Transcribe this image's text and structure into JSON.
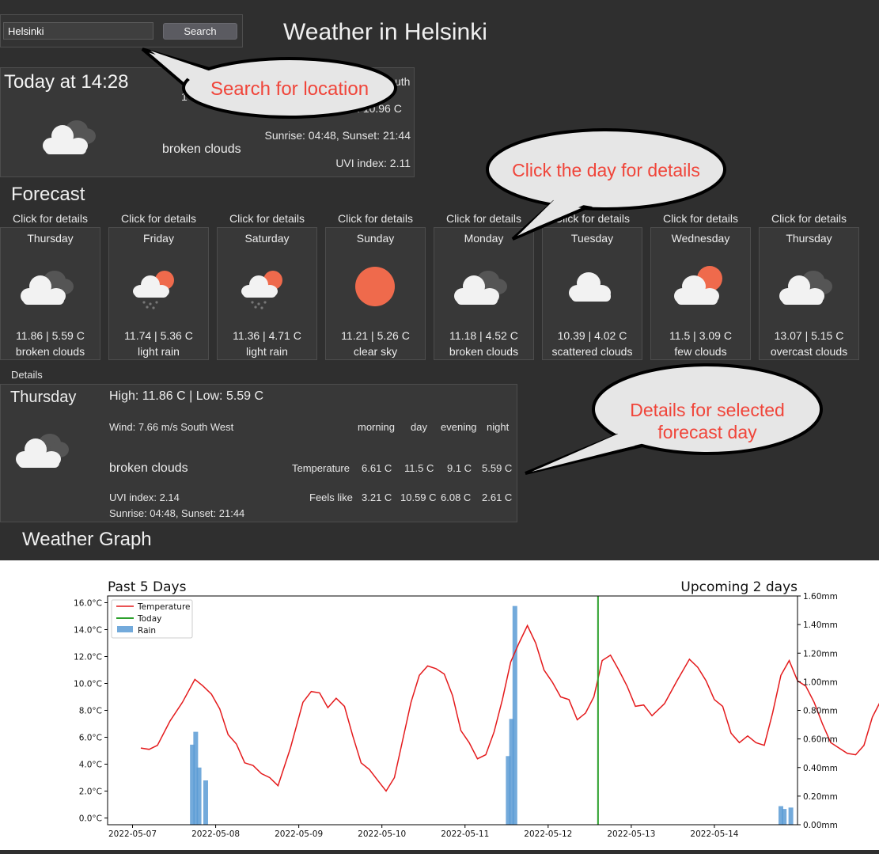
{
  "search": {
    "value": "Helsinki",
    "button_label": "Search"
  },
  "title": "Weather in Helsinki",
  "today": {
    "heading": "Today at 14:28",
    "wind_partial": "uth",
    "temp_partial_left": "1",
    "temp_partial_right": ". 10.96 C",
    "sun": "Sunrise: 04:48, Sunset: 21:44",
    "uvi": "UVI index: 2.11",
    "description": "broken clouds",
    "icon": "broken-clouds-icon"
  },
  "callouts": {
    "search": "Search for location",
    "click_day": "Click the day for details",
    "details": "Details for selected forecast day"
  },
  "forecast": {
    "heading": "Forecast",
    "click_label": "Click for details",
    "days": [
      {
        "name": "Thursday",
        "temps": "11.86 | 5.59 C",
        "desc": "broken clouds",
        "icon": "broken-clouds-icon"
      },
      {
        "name": "Friday",
        "temps": "11.74 | 5.36 C",
        "desc": "light rain",
        "icon": "light-rain-icon"
      },
      {
        "name": "Saturday",
        "temps": "11.36 | 4.71 C",
        "desc": "light rain",
        "icon": "light-rain-icon"
      },
      {
        "name": "Sunday",
        "temps": "11.21 | 5.26 C",
        "desc": "clear sky",
        "icon": "clear-sky-icon"
      },
      {
        "name": "Monday",
        "temps": "11.18 | 4.52 C",
        "desc": "broken clouds",
        "icon": "broken-clouds-icon"
      },
      {
        "name": "Tuesday",
        "temps": "10.39 | 4.02 C",
        "desc": "scattered clouds",
        "icon": "scattered-clouds-icon"
      },
      {
        "name": "Wednesday",
        "temps": "11.5 | 3.09 C",
        "desc": "few clouds",
        "icon": "few-clouds-icon"
      },
      {
        "name": "Thursday",
        "temps": "13.07 | 5.15 C",
        "desc": "overcast clouds",
        "icon": "overcast-clouds-icon"
      }
    ]
  },
  "details": {
    "label": "Details",
    "day": "Thursday",
    "high_low": "High: 11.86 C | Low: 5.59 C",
    "wind": "Wind: 7.66 m/s South West",
    "description": "broken clouds",
    "uvi": "UVI index: 2.14",
    "sun": "Sunrise: 04:48, Sunset: 21:44",
    "columns": [
      "morning",
      "day",
      "evening",
      "night"
    ],
    "rows": [
      {
        "label": "Temperature",
        "values": [
          "6.61 C",
          "11.5 C",
          "9.1 C",
          "5.59 C"
        ]
      },
      {
        "label": "Feels like",
        "values": [
          "3.21 C",
          "10.59 C",
          "6.08 C",
          "2.61 C"
        ]
      }
    ],
    "icon": "broken-clouds-icon"
  },
  "graph_heading": "Weather Graph",
  "chart_data": {
    "type": "line",
    "title_left": "Past 5 Days",
    "title_right": "Upcoming 2 days",
    "x_ticks": [
      "2022-05-07",
      "2022-05-08",
      "2022-05-09",
      "2022-05-10",
      "2022-05-11",
      "2022-05-12",
      "2022-05-13",
      "2022-05-14"
    ],
    "y_left_ticks": [
      "0.0°C",
      "2.0°C",
      "4.0°C",
      "6.0°C",
      "8.0°C",
      "10.0°C",
      "12.0°C",
      "14.0°C",
      "16.0°C"
    ],
    "y_right_ticks": [
      "0.00mm",
      "0.20mm",
      "0.40mm",
      "0.60mm",
      "0.80mm",
      "1.00mm",
      "1.20mm",
      "1.40mm",
      "1.60mm"
    ],
    "ylim_left": [
      -0.5,
      16.5
    ],
    "ylim_right": [
      0,
      1.6
    ],
    "xlim": [
      -0.3,
      8.0
    ],
    "legend": [
      "Temperature",
      "Today",
      "Rain"
    ],
    "legend_position": "top-left",
    "colors": {
      "temperature": "#e41a1c",
      "today": "#2ca02c",
      "rain": "#5b9bd5"
    },
    "today_x": 5.6,
    "temperature": [
      [
        0.1,
        5.2
      ],
      [
        0.2,
        5.1
      ],
      [
        0.3,
        5.4
      ],
      [
        0.45,
        7.2
      ],
      [
        0.6,
        8.6
      ],
      [
        0.75,
        10.3
      ],
      [
        0.85,
        9.8
      ],
      [
        0.95,
        9.2
      ],
      [
        1.05,
        8.1
      ],
      [
        1.15,
        6.2
      ],
      [
        1.25,
        5.5
      ],
      [
        1.35,
        4.1
      ],
      [
        1.45,
        3.9
      ],
      [
        1.55,
        3.3
      ],
      [
        1.65,
        3.0
      ],
      [
        1.75,
        2.4
      ],
      [
        1.9,
        5.2
      ],
      [
        2.05,
        8.6
      ],
      [
        2.15,
        9.4
      ],
      [
        2.25,
        9.3
      ],
      [
        2.35,
        8.2
      ],
      [
        2.45,
        8.9
      ],
      [
        2.55,
        8.3
      ],
      [
        2.65,
        6.1
      ],
      [
        2.75,
        4.1
      ],
      [
        2.85,
        3.6
      ],
      [
        2.95,
        2.8
      ],
      [
        3.05,
        2.0
      ],
      [
        3.15,
        3.0
      ],
      [
        3.25,
        5.8
      ],
      [
        3.35,
        8.6
      ],
      [
        3.45,
        10.6
      ],
      [
        3.55,
        11.3
      ],
      [
        3.65,
        11.1
      ],
      [
        3.75,
        10.7
      ],
      [
        3.85,
        9.1
      ],
      [
        3.95,
        6.5
      ],
      [
        4.05,
        5.6
      ],
      [
        4.15,
        4.4
      ],
      [
        4.25,
        4.7
      ],
      [
        4.35,
        6.4
      ],
      [
        4.45,
        8.8
      ],
      [
        4.55,
        11.6
      ],
      [
        4.65,
        13.0
      ],
      [
        4.75,
        14.3
      ],
      [
        4.85,
        13.0
      ],
      [
        4.95,
        11.0
      ],
      [
        5.05,
        10.1
      ],
      [
        5.15,
        9.0
      ],
      [
        5.25,
        8.8
      ],
      [
        5.35,
        7.3
      ],
      [
        5.45,
        7.8
      ],
      [
        5.55,
        9.0
      ],
      [
        5.65,
        11.7
      ],
      [
        5.75,
        12.1
      ],
      [
        5.85,
        11.0
      ],
      [
        5.95,
        9.8
      ],
      [
        6.05,
        8.3
      ],
      [
        6.15,
        8.4
      ],
      [
        6.25,
        7.6
      ],
      [
        6.4,
        8.5
      ],
      [
        6.55,
        10.2
      ],
      [
        6.7,
        11.8
      ],
      [
        6.8,
        11.2
      ],
      [
        6.9,
        10.2
      ],
      [
        7.0,
        8.8
      ],
      [
        7.1,
        8.3
      ],
      [
        7.2,
        6.3
      ],
      [
        7.3,
        5.6
      ],
      [
        7.4,
        6.1
      ],
      [
        7.5,
        5.6
      ],
      [
        7.6,
        5.4
      ],
      [
        7.7,
        7.8
      ],
      [
        7.8,
        10.6
      ],
      [
        7.9,
        11.7
      ],
      [
        8.0,
        10.2
      ],
      [
        8.1,
        9.8
      ],
      [
        8.2,
        8.6
      ],
      [
        8.3,
        7.0
      ],
      [
        8.4,
        5.6
      ],
      [
        8.5,
        5.2
      ],
      [
        8.6,
        4.8
      ],
      [
        8.7,
        4.7
      ],
      [
        8.8,
        5.4
      ],
      [
        8.9,
        7.5
      ],
      [
        9.0,
        8.7
      ],
      [
        9.1,
        10.4
      ],
      [
        9.2,
        11.0
      ]
    ],
    "rain": [
      [
        0.72,
        0.56
      ],
      [
        0.76,
        0.65
      ],
      [
        0.8,
        0.4
      ],
      [
        0.88,
        0.31
      ],
      [
        4.52,
        0.48
      ],
      [
        4.56,
        0.74
      ],
      [
        4.6,
        1.53
      ],
      [
        7.8,
        0.13
      ],
      [
        7.84,
        0.11
      ],
      [
        7.92,
        0.12
      ],
      [
        9.05,
        0.17
      ]
    ]
  }
}
